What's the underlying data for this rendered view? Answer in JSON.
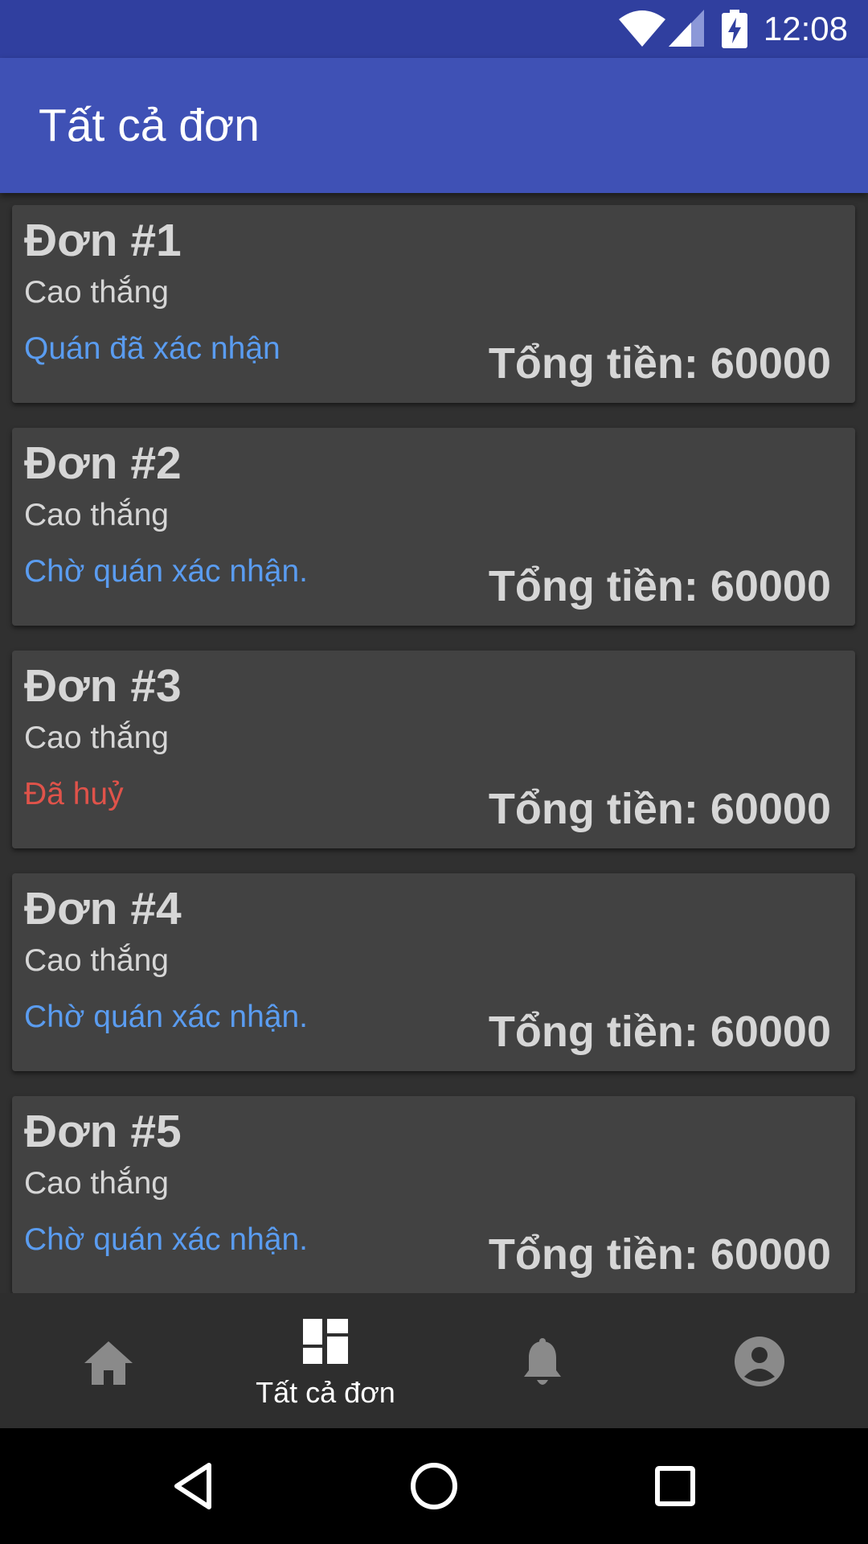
{
  "status_bar": {
    "time": "12:08",
    "icons": [
      "wifi-icon",
      "signal-icon",
      "battery-charging-icon"
    ]
  },
  "app_bar": {
    "title": "Tất cả đơn"
  },
  "orders": [
    {
      "id": "Đơn #1",
      "store": "Cao thắng",
      "status": "Quán đã xác nhận",
      "status_color": "#5A9CF0",
      "total": "Tổng tiền: 60000"
    },
    {
      "id": "Đơn #2",
      "store": "Cao thắng",
      "status": "Chờ quán xác nhận.",
      "status_color": "#5A9CF0",
      "total": "Tổng tiền: 60000"
    },
    {
      "id": "Đơn #3",
      "store": "Cao thắng",
      "status": "Đã huỷ",
      "status_color": "#E0534A",
      "total": "Tổng tiền: 60000"
    },
    {
      "id": "Đơn #4",
      "store": "Cao thắng",
      "status": "Chờ quán xác nhận.",
      "status_color": "#5A9CF0",
      "total": "Tổng tiền: 60000"
    },
    {
      "id": "Đơn #5",
      "store": "Cao thắng",
      "status": "Chờ quán xác nhận.",
      "status_color": "#5A9CF0",
      "total": "Tổng tiền: 60000"
    }
  ],
  "bottom_nav": {
    "items": [
      {
        "icon": "home-icon",
        "label": "",
        "active": false
      },
      {
        "icon": "dashboard-icon",
        "label": "Tất cả đơn",
        "active": true
      },
      {
        "icon": "bell-icon",
        "label": "",
        "active": false
      },
      {
        "icon": "account-icon",
        "label": "",
        "active": false
      }
    ]
  },
  "system_nav": [
    "back-icon",
    "home-circle-icon",
    "recents-icon"
  ],
  "colors": {
    "primary": "#3F51B5",
    "primary_dark": "#303F9F",
    "background": "#303030",
    "card": "#424242"
  }
}
